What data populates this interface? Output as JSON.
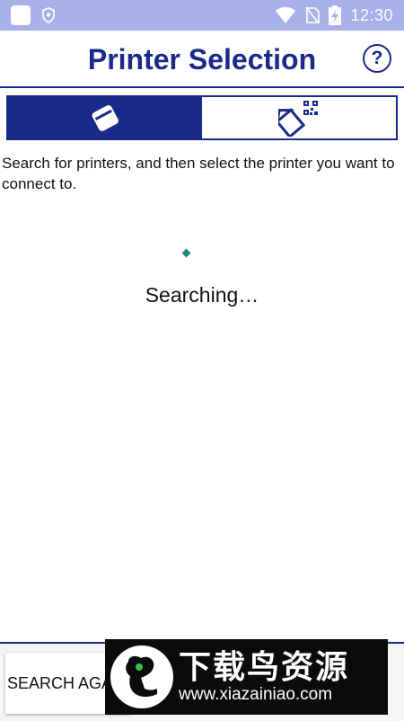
{
  "status_bar": {
    "time": "12:30",
    "icons": [
      "notification-square-icon",
      "shield-icon",
      "wifi-icon",
      "no-sim-icon",
      "battery-charging-icon"
    ]
  },
  "header": {
    "title": "Printer Selection",
    "help_label": "?"
  },
  "tabs": [
    {
      "icon": "printer-icon",
      "active": true
    },
    {
      "icon": "qr-code-printer-icon",
      "active": false
    }
  ],
  "instructions": "Search for printers, and then select the printer you want to connect to.",
  "status_text": "Searching…",
  "bottom": {
    "search_again_label": "SEARCH AGAIN"
  },
  "watermark": {
    "name": "下载鸟资源",
    "url": "www.xiazainiao.com"
  },
  "colors": {
    "brand": "#1a2a8a",
    "status_bar": "#a9b1ea",
    "spinner": "#1a8a80"
  }
}
